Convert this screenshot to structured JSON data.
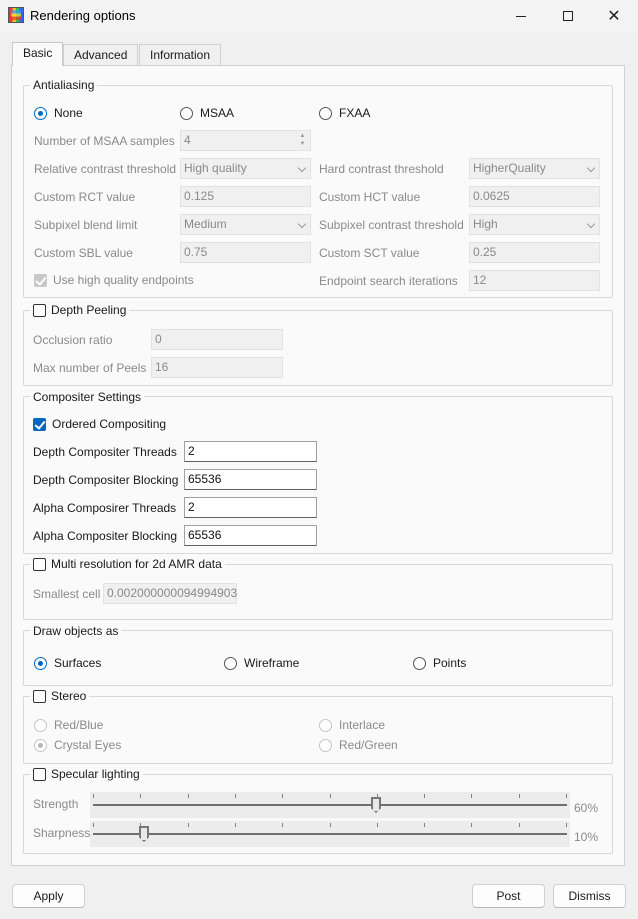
{
  "window": {
    "title": "Rendering options"
  },
  "tabs": [
    {
      "label": "Basic"
    },
    {
      "label": "Advanced"
    },
    {
      "label": "Information"
    }
  ],
  "antialiasing": {
    "title": "Antialiasing",
    "modes": {
      "none": "None",
      "msaa": "MSAA",
      "fxaa": "FXAA"
    },
    "selected_mode": "None",
    "msaa_samples_label": "Number of MSAA samples",
    "msaa_samples": "4",
    "rct_label": "Relative contrast threshold",
    "rct_value": "High quality",
    "hct_label": "Hard contrast threshold",
    "hct_value": "HigherQuality",
    "custom_rct_label": "Custom RCT value",
    "custom_rct": "0.125",
    "custom_hct_label": "Custom HCT value",
    "custom_hct": "0.0625",
    "sbl_label": "Subpixel blend limit",
    "sbl_value": "Medium",
    "sct_label": "Subpixel contrast threshold",
    "sct_value": "High",
    "custom_sbl_label": "Custom SBL value",
    "custom_sbl": "0.75",
    "custom_sct_label": "Custom SCT value",
    "custom_sct": "0.25",
    "hq_endpoints_label": "Use high quality endpoints",
    "hq_endpoints_checked": true,
    "endpoint_iter_label": "Endpoint search iterations",
    "endpoint_iter": "12"
  },
  "depth_peeling": {
    "title": "Depth Peeling",
    "checked": false,
    "occlusion_label": "Occlusion ratio",
    "occlusion": "0",
    "max_peels_label": "Max number of Peels",
    "max_peels": "16"
  },
  "compositer": {
    "title": "Compositer Settings",
    "ordered_label": "Ordered Compositing",
    "ordered_checked": true,
    "depth_threads_label": "Depth Compositer Threads",
    "depth_threads": "2",
    "depth_blocking_label": "Depth Compositer Blocking",
    "depth_blocking": "65536",
    "alpha_threads_label": "Alpha Composirer Threads",
    "alpha_threads": "2",
    "alpha_blocking_label": "Alpha Compositer Blocking",
    "alpha_blocking": "65536"
  },
  "multires": {
    "title": "Multi resolution for 2d AMR data",
    "checked": false,
    "smallest_label": "Smallest cell",
    "smallest": "0.002000000094994903"
  },
  "draw_as": {
    "title": "Draw objects as",
    "options": {
      "surfaces": "Surfaces",
      "wireframe": "Wireframe",
      "points": "Points"
    },
    "selected": "Surfaces"
  },
  "stereo": {
    "title": "Stereo",
    "checked": false,
    "options": {
      "red_blue": "Red/Blue",
      "interlace": "Interlace",
      "crystal_eyes": "Crystal Eyes",
      "red_green": "Red/Green"
    },
    "selected": "Crystal Eyes"
  },
  "specular": {
    "title": "Specular lighting",
    "checked": false,
    "strength_label": "Strength",
    "strength_value": 0.6,
    "strength_text": "60%",
    "sharpness_label": "Sharpness",
    "sharpness_value": 0.1,
    "sharpness_text": "10%"
  },
  "buttons": {
    "apply": "Apply",
    "post": "Post",
    "dismiss": "Dismiss"
  }
}
